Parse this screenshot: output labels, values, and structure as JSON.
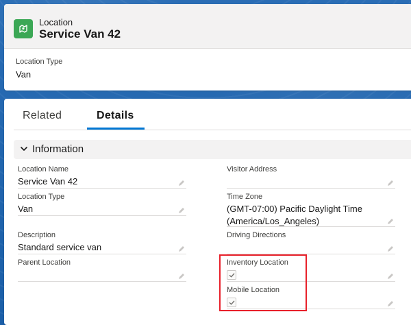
{
  "header": {
    "object_type": "Location",
    "record_name": "Service Van 42",
    "icon": "location-icon",
    "icon_color": "#3ba755",
    "highlight": {
      "label": "Location Type",
      "value": "Van"
    }
  },
  "tabs": [
    {
      "label": "Related",
      "active": false
    },
    {
      "label": "Details",
      "active": true
    }
  ],
  "section": {
    "title": "Information",
    "expanded": true
  },
  "fields": {
    "location_name": {
      "label": "Location Name",
      "value": "Service Van 42"
    },
    "location_type": {
      "label": "Location Type",
      "value": "Van"
    },
    "description": {
      "label": "Description",
      "value": "Standard service van"
    },
    "parent_location": {
      "label": "Parent Location",
      "value": ""
    },
    "visitor_address": {
      "label": "Visitor Address",
      "value": ""
    },
    "time_zone": {
      "label": "Time Zone",
      "value_line1": "(GMT-07:00) Pacific Daylight Time",
      "value_line2": "(America/Los_Angeles)"
    },
    "driving_directions": {
      "label": "Driving Directions",
      "value": ""
    },
    "inventory_location": {
      "label": "Inventory Location",
      "checked": true
    },
    "mobile_location": {
      "label": "Mobile Location",
      "checked": true
    }
  },
  "colors": {
    "accent": "#0176d3",
    "highlight_border": "#e8202a",
    "background": "#1b5fa8"
  }
}
